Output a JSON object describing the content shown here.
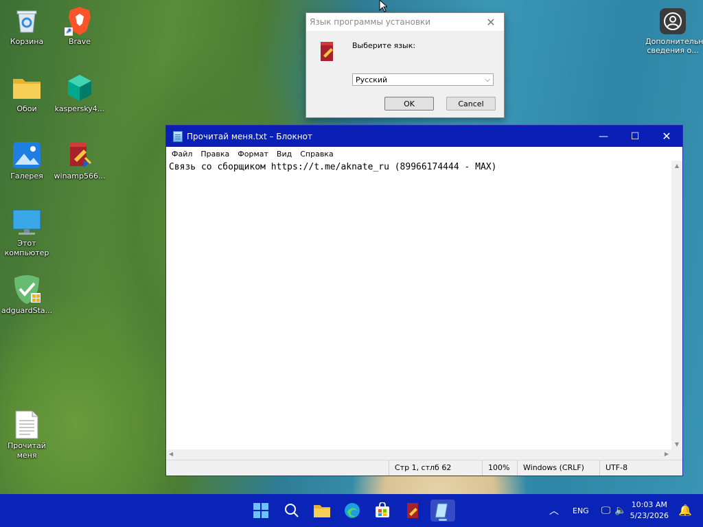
{
  "desktop": {
    "icons": [
      {
        "label": "Корзина",
        "icon": "recycle-bin-icon"
      },
      {
        "label": "Brave",
        "icon": "brave-icon"
      },
      {
        "label": "Обои",
        "icon": "folder-icon"
      },
      {
        "label": "kaspersky4...",
        "icon": "kaspersky-icon"
      },
      {
        "label": "Галерея",
        "icon": "gallery-icon"
      },
      {
        "label": "winamp566...",
        "icon": "winamp-installer-icon"
      },
      {
        "label": "Этот компьютер",
        "icon": "computer-icon"
      },
      {
        "label": "adguardSta...",
        "icon": "adguard-icon"
      },
      {
        "label": "Прочитай меня",
        "icon": "text-file-icon"
      }
    ],
    "right_icon": {
      "label": "Дополнительные сведения о...",
      "icon": "user-circle-icon"
    }
  },
  "dialog": {
    "title": "Язык программы установки",
    "prompt": "Выберите язык:",
    "selected_language": "Русский",
    "ok_label": "OK",
    "cancel_label": "Cancel"
  },
  "notepad": {
    "title": "Прочитай меня.txt – Блокнот",
    "menu": [
      "Файл",
      "Правка",
      "Формат",
      "Вид",
      "Справка"
    ],
    "content": "Связь со сборщиком https://t.me/aknate_ru (89966174444 - MAX)",
    "status": {
      "position": "Стр 1, стлб 62",
      "zoom": "100%",
      "line_endings": "Windows (CRLF)",
      "encoding": "UTF-8"
    }
  },
  "taskbar": {
    "language": "ENG",
    "time": "10:03 AM",
    "date": "5/23/2026",
    "apps": [
      "start",
      "search",
      "file-explorer",
      "edge",
      "store",
      "winamp-installer",
      "notepad"
    ]
  },
  "colors": {
    "taskbar": "#0a24b7",
    "notepad_titlebar": "#0a1fb5"
  }
}
